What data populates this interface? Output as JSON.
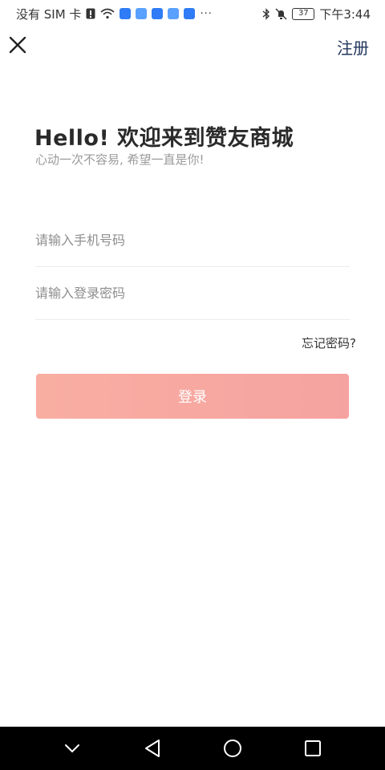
{
  "status_bar": {
    "carrier": "没有 SIM 卡",
    "battery_level": "37",
    "time": "下午3:44"
  },
  "nav": {
    "register": "注册"
  },
  "header": {
    "title": "Hello! 欢迎来到赞友商城",
    "subtitle": "心动一次不容易, 希望一直是你!"
  },
  "form": {
    "phone_placeholder": "请输入手机号码",
    "password_placeholder": "请输入登录密码",
    "forgot_password": "忘记密码?",
    "login_button": "登录"
  },
  "colors": {
    "accent": "#22375e",
    "login_button": "#f7a9a0"
  }
}
